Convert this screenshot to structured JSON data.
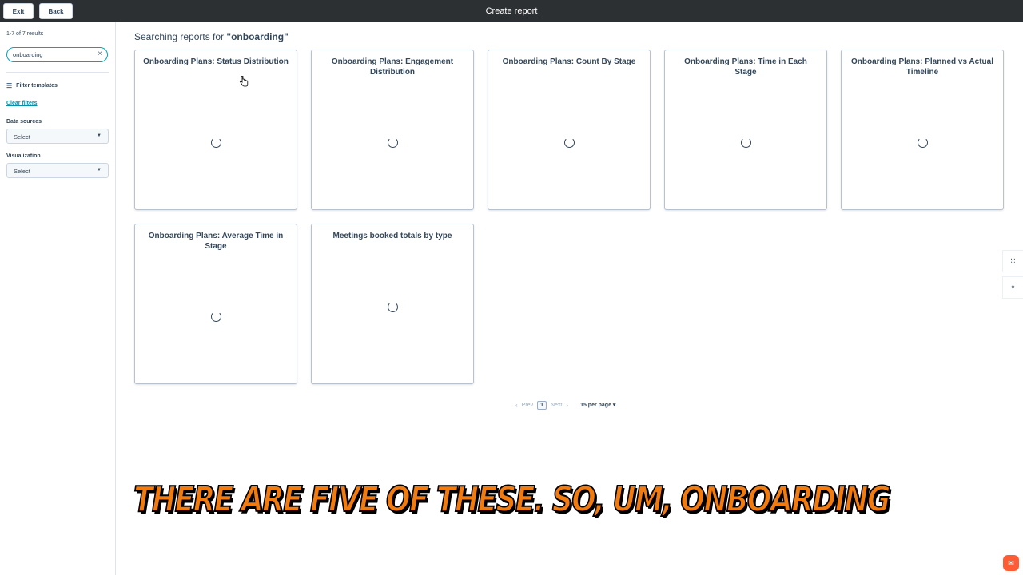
{
  "topbar": {
    "exit_label": "Exit",
    "back_label": "Back",
    "title": "Create report"
  },
  "sidebar": {
    "results_count": "1-7 of 7 results",
    "search_value": "onboarding",
    "filter_templates_label": "Filter templates",
    "clear_filters_label": "Clear filters",
    "data_sources": {
      "label": "Data sources",
      "value": "Select"
    },
    "visualization": {
      "label": "Visualization",
      "value": "Select"
    }
  },
  "main": {
    "heading_prefix": "Searching reports for ",
    "heading_query": "\"onboarding\"",
    "cards": [
      {
        "title": "Onboarding Plans: Status Distribution"
      },
      {
        "title": "Onboarding Plans: Engagement Distribution"
      },
      {
        "title": "Onboarding Plans: Count By Stage"
      },
      {
        "title": "Onboarding Plans: Time in Each Stage"
      },
      {
        "title": "Onboarding Plans: Planned vs Actual Timeline"
      },
      {
        "title": "Onboarding Plans: Average Time in Stage"
      },
      {
        "title": "Meetings booked totals by type"
      }
    ]
  },
  "pagination": {
    "prev_label": "Prev",
    "current_page": "1",
    "next_label": "Next",
    "per_page_label": "15 per page"
  },
  "icons": {
    "filter": "filter-icon",
    "clear": "close-icon",
    "caret": "caret-down-icon",
    "grid": "grid-icon",
    "sparkle": "sparkle-icon",
    "help": "help-icon"
  },
  "caption": "THERE ARE FIVE OF THESE. SO, UM, ONBOARDING",
  "colors": {
    "topbar": "#2d3033",
    "accent": "#00a4bd",
    "link": "#0091ae",
    "caption": "#f27b0f",
    "help": "#ff5c35"
  }
}
